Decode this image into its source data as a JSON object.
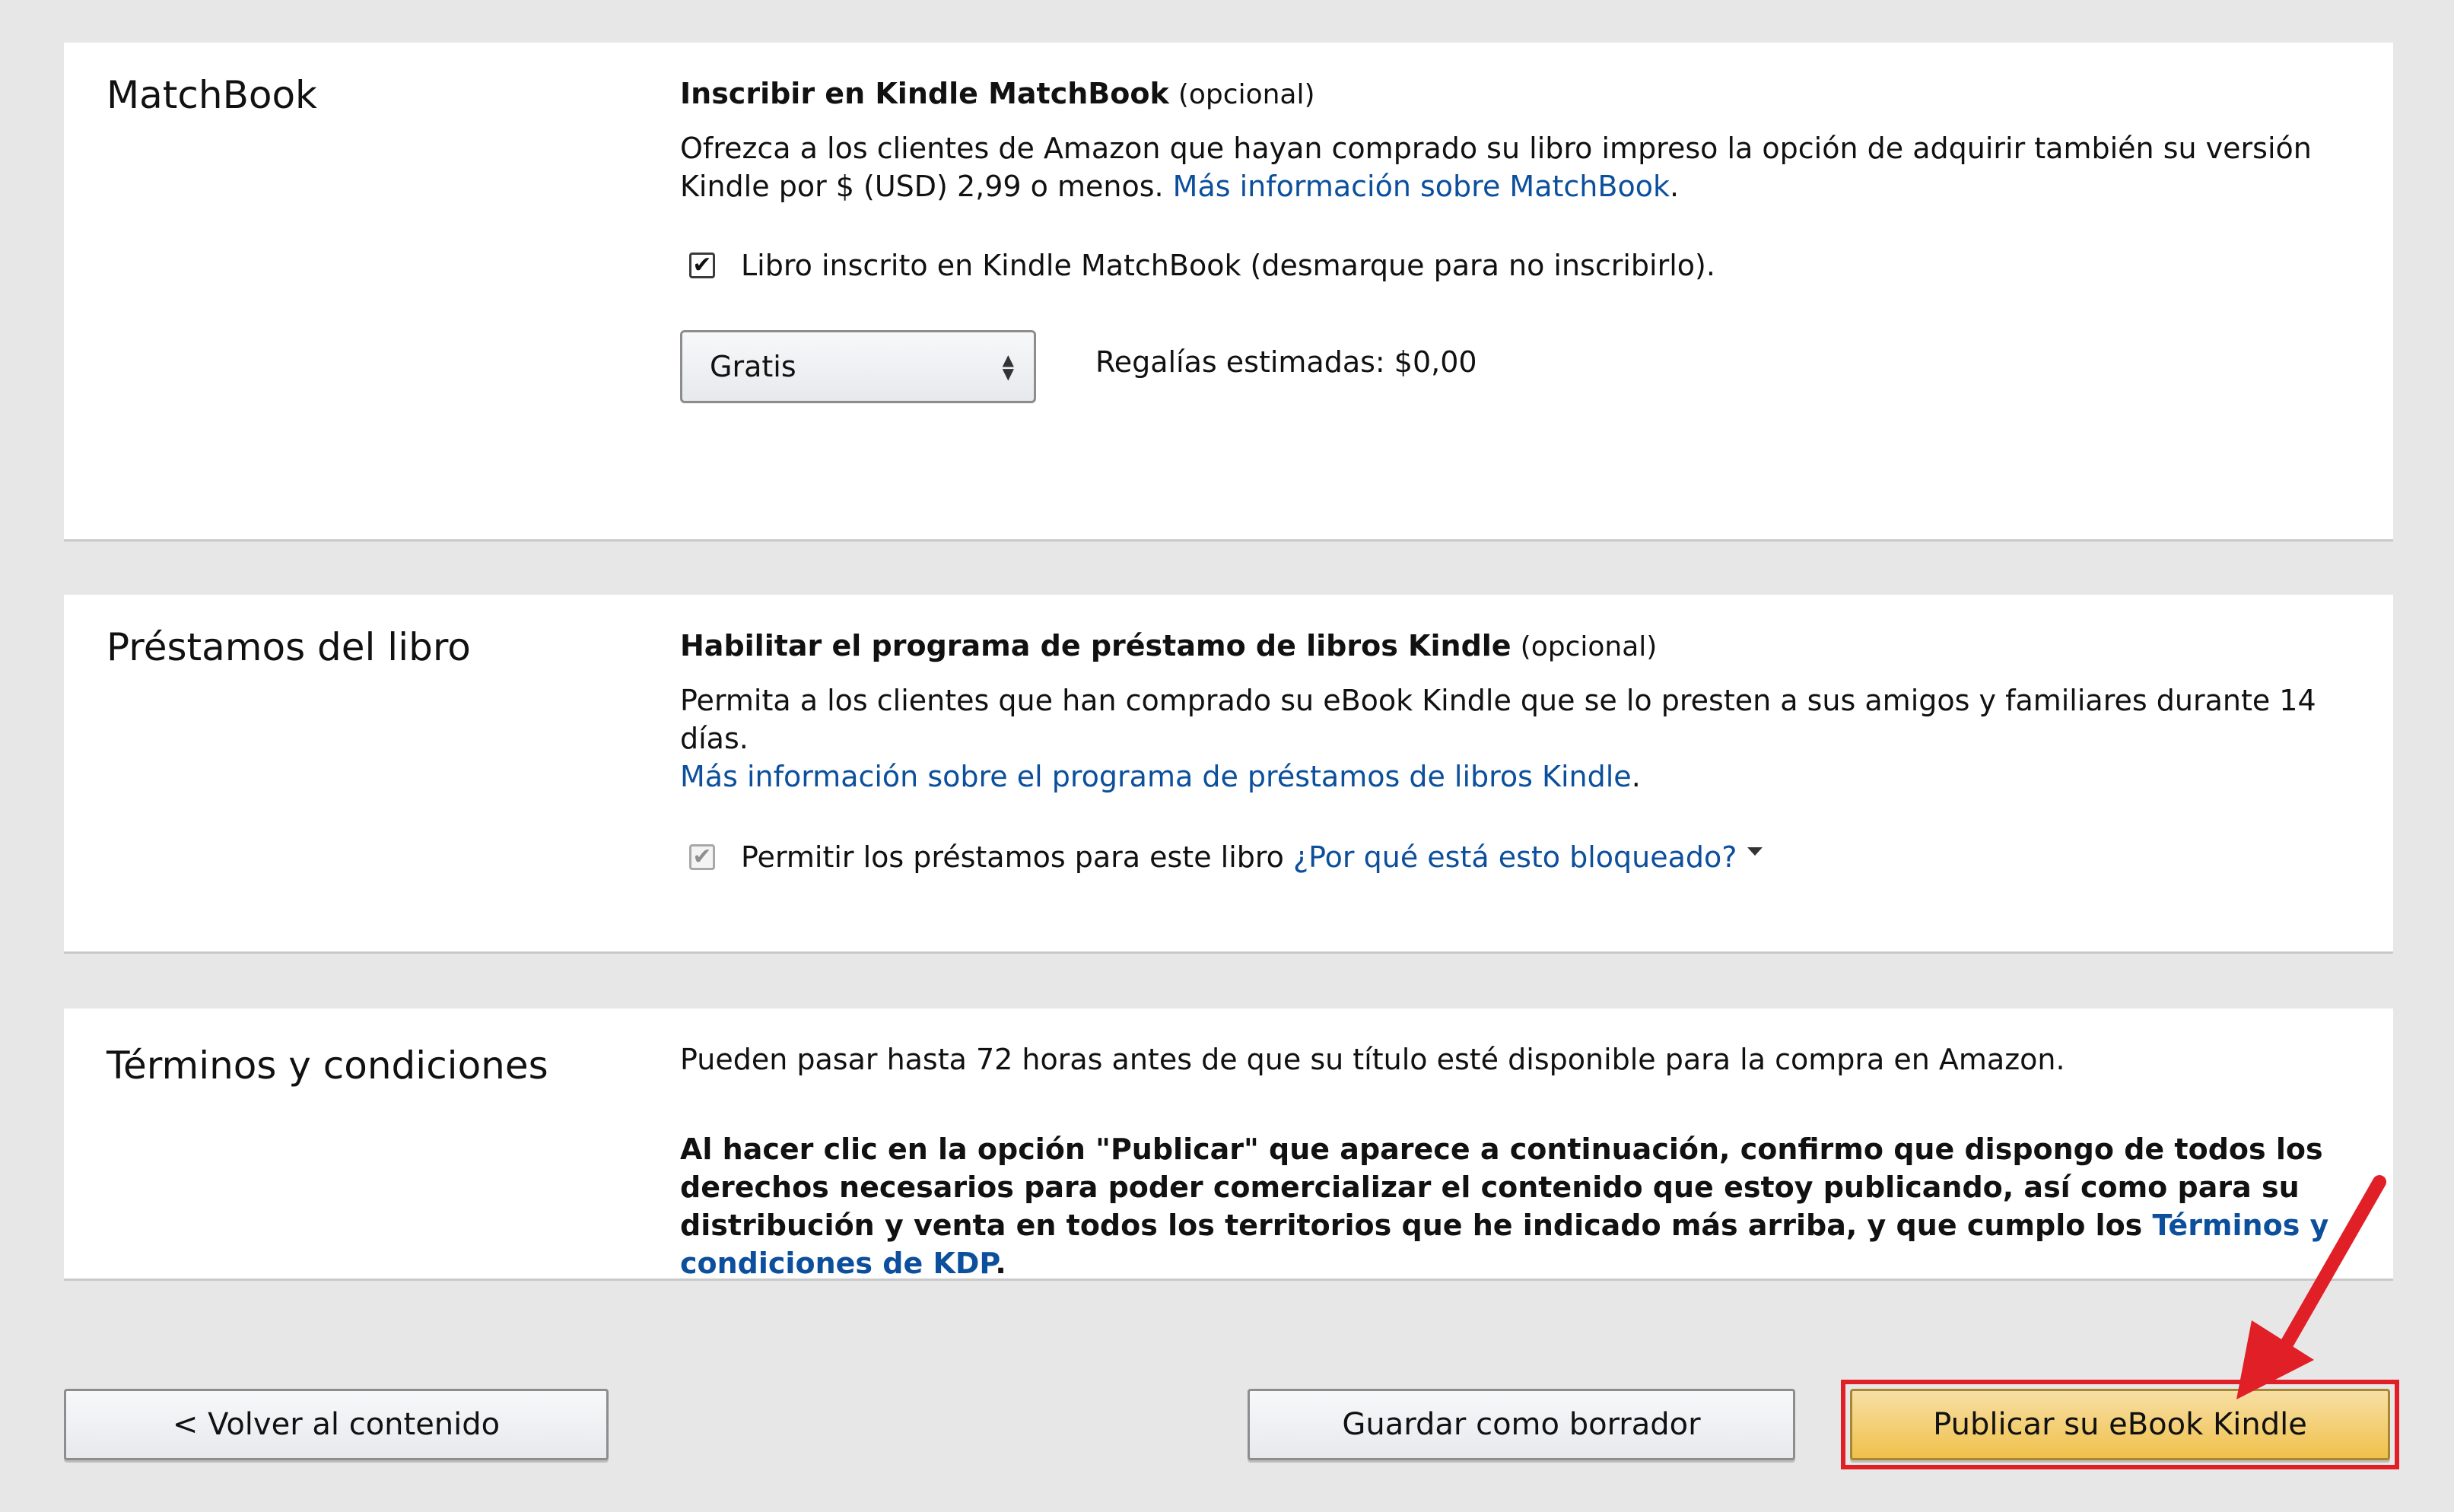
{
  "matchbook": {
    "title": "MatchBook",
    "heading": "Inscribir en Kindle MatchBook",
    "optional": "(opcional)",
    "description": "Ofrezca a los clientes de Amazon que hayan comprado su libro impreso la opción de adquirir también su versión Kindle por $ (USD) 2,99 o menos.",
    "link": "Más información sobre MatchBook",
    "link_suffix": ".",
    "checkbox_label": "Libro inscrito en Kindle MatchBook (desmarque para no inscribirlo).",
    "checkbox_checked": true,
    "price_select_value": "Gratis",
    "royalty_text": "Regalías estimadas: $0,00"
  },
  "lending": {
    "title": "Préstamos del libro",
    "heading": "Habilitar el programa de préstamo de libros Kindle",
    "optional": "(opcional)",
    "description": "Permita a los clientes que han comprado su eBook Kindle que se lo presten a sus amigos y familiares durante 14 días.",
    "link": "Más información sobre el programa de préstamos de libros Kindle",
    "link_suffix": ".",
    "checkbox_label": "Permitir los préstamos para este libro",
    "checkbox_checked": true,
    "checkbox_disabled": true,
    "blocked_link": "¿Por qué está esto bloqueado?"
  },
  "terms": {
    "title": "Términos y condiciones",
    "availability_text": "Pueden pasar hasta 72 horas antes de que su título esté disponible para la compra en Amazon.",
    "agreement_text": "Al hacer clic en la opción \"Publicar\" que aparece a continuación, confirmo que dispongo de todos los derechos necesarios para poder comercializar el contenido que estoy publicando, así como para su distribución y venta en todos los territorios que he indicado más arriba, y que cumplo los",
    "terms_link": "Términos y condiciones de KDP",
    "terms_suffix": "."
  },
  "actions": {
    "back_label": "< Volver al contenido",
    "draft_label": "Guardar como borrador",
    "publish_label": "Publicar su eBook Kindle"
  },
  "annotation": {
    "highlight_color": "#e11f26"
  },
  "icons": {
    "checkbox_check": "check-icon",
    "select_arrows": "updown-arrows-icon",
    "dropdown_caret": "caret-down-icon",
    "annotation_arrow": "red-arrow-icon"
  }
}
